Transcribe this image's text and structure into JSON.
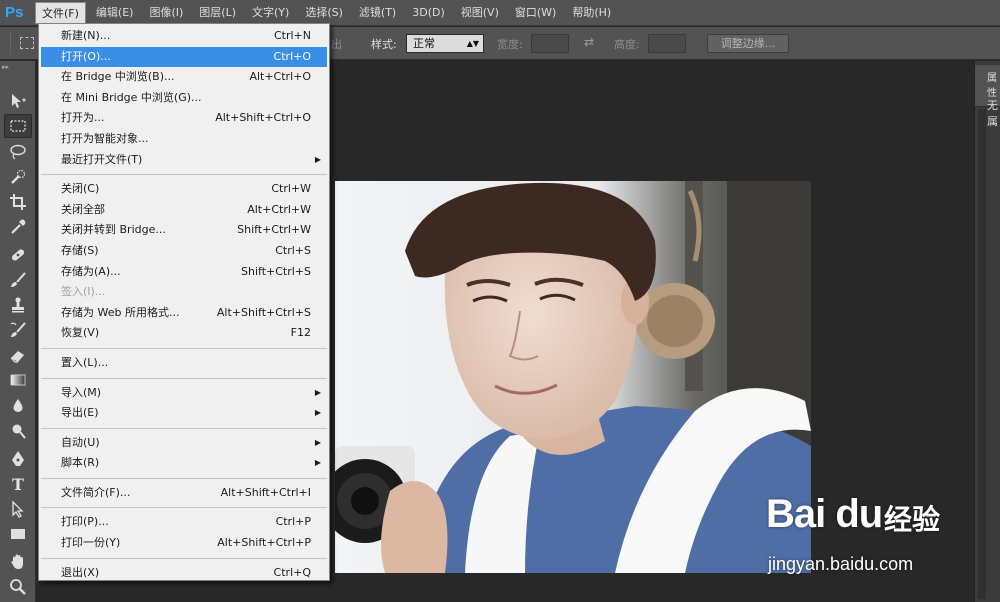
{
  "app": {
    "logo": "Ps"
  },
  "menubar": {
    "items": [
      "文件(F)",
      "编辑(E)",
      "图像(I)",
      "图层(L)",
      "文字(Y)",
      "选择(S)",
      "滤镜(T)",
      "3D(D)",
      "视图(V)",
      "窗口(W)",
      "帮助(H)"
    ]
  },
  "options": {
    "feather_partial": "出",
    "style_label": "样式:",
    "style_value": "正常",
    "width_label": "宽度:",
    "height_label": "高度:",
    "refine_edge": "调整边缘..."
  },
  "right_panel": {
    "tab_label": "属性",
    "content": "无属"
  },
  "file_menu": {
    "groups": [
      [
        {
          "label": "新建(N)...",
          "shortcut": "Ctrl+N"
        },
        {
          "label": "打开(O)...",
          "shortcut": "Ctrl+O",
          "highlighted": true
        },
        {
          "label": "在 Bridge 中浏览(B)...",
          "shortcut": "Alt+Ctrl+O"
        },
        {
          "label": "在 Mini Bridge 中浏览(G)...",
          "shortcut": ""
        },
        {
          "label": "打开为...",
          "shortcut": "Alt+Shift+Ctrl+O"
        },
        {
          "label": "打开为智能对象...",
          "shortcut": ""
        },
        {
          "label": "最近打开文件(T)",
          "shortcut": "",
          "submenu": true
        }
      ],
      [
        {
          "label": "关闭(C)",
          "shortcut": "Ctrl+W"
        },
        {
          "label": "关闭全部",
          "shortcut": "Alt+Ctrl+W"
        },
        {
          "label": "关闭并转到 Bridge...",
          "shortcut": "Shift+Ctrl+W"
        },
        {
          "label": "存储(S)",
          "shortcut": "Ctrl+S"
        },
        {
          "label": "存储为(A)...",
          "shortcut": "Shift+Ctrl+S"
        },
        {
          "label": "签入(I)...",
          "shortcut": "",
          "disabled": true
        },
        {
          "label": "存储为 Web 所用格式...",
          "shortcut": "Alt+Shift+Ctrl+S"
        },
        {
          "label": "恢复(V)",
          "shortcut": "F12"
        }
      ],
      [
        {
          "label": "置入(L)...",
          "shortcut": ""
        }
      ],
      [
        {
          "label": "导入(M)",
          "shortcut": "",
          "submenu": true
        },
        {
          "label": "导出(E)",
          "shortcut": "",
          "submenu": true
        }
      ],
      [
        {
          "label": "自动(U)",
          "shortcut": "",
          "submenu": true
        },
        {
          "label": "脚本(R)",
          "shortcut": "",
          "submenu": true
        }
      ],
      [
        {
          "label": "文件简介(F)...",
          "shortcut": "Alt+Shift+Ctrl+I"
        }
      ],
      [
        {
          "label": "打印(P)...",
          "shortcut": "Ctrl+P"
        },
        {
          "label": "打印一份(Y)",
          "shortcut": "Alt+Shift+Ctrl+P"
        }
      ],
      [
        {
          "label": "退出(X)",
          "shortcut": "Ctrl+Q"
        }
      ]
    ]
  },
  "watermark": {
    "brand": "Bai du",
    "product": "经验",
    "url": "jingyan.baidu.com"
  },
  "colors": {
    "highlight": "#3a8ee6",
    "chrome": "#535353",
    "canvas": "#282828"
  }
}
